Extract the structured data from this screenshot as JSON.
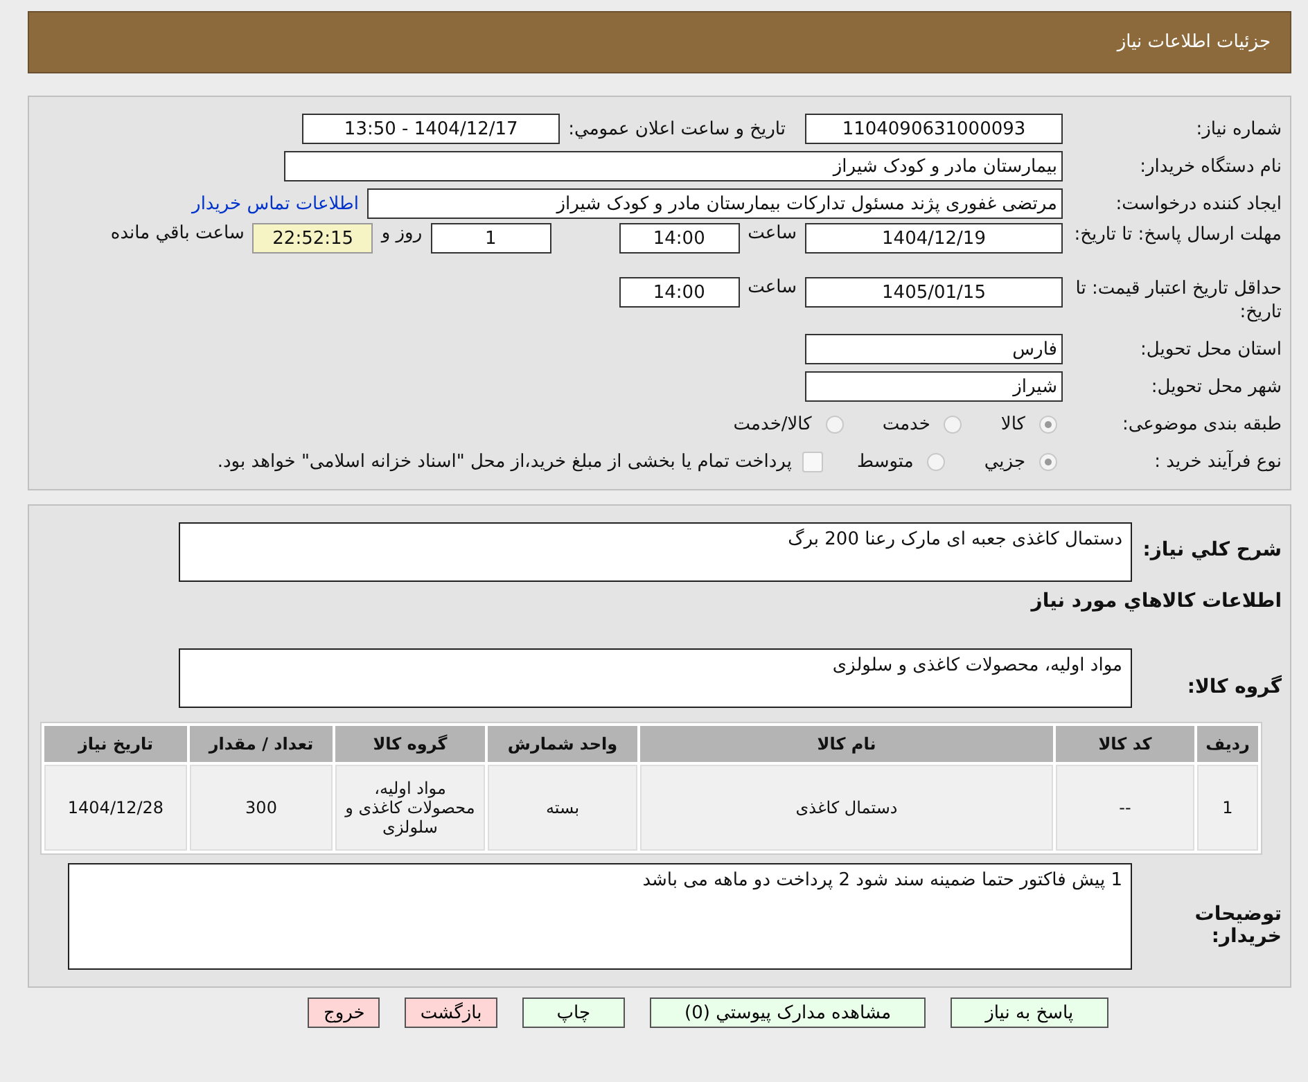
{
  "header": {
    "title": "جزئیات اطلاعات نیاز"
  },
  "need_number": {
    "label": "شماره نیاز:",
    "value": "1104090631000093"
  },
  "announce": {
    "label": "تاریخ و ساعت اعلان عمومي:",
    "value": "1404/12/17 - 13:50"
  },
  "buyer": {
    "label": "نام دستگاه خریدار:",
    "value": "بیمارستان مادر و کودک شیراز"
  },
  "requester": {
    "label": "ایجاد کننده درخواست:",
    "value": "مرتضی غفوری پژند مسئول تدارکات  بیمارستان مادر و کودک شیراز",
    "link": "اطلاعات تماس خریدار"
  },
  "deadline": {
    "label": "مهلت ارسال پاسخ: تا تاریخ:",
    "date": "1404/12/19",
    "time_label": "ساعت",
    "time": "14:00",
    "days": "1",
    "days_label": "روز و",
    "remaining": "22:52:15",
    "remaining_label": "ساعت باقي مانده"
  },
  "validity": {
    "label": "حداقل تاریخ اعتبار قیمت: تا تاریخ:",
    "date": "1405/01/15",
    "time_label": "ساعت",
    "time": "14:00"
  },
  "province": {
    "label": "استان محل تحویل:",
    "value": "فارس"
  },
  "city": {
    "label": "شهر محل تحویل:",
    "value": "شیراز"
  },
  "category": {
    "label": "طبقه بندی موضوعی:",
    "options": [
      {
        "label": "کالا",
        "selected": true
      },
      {
        "label": "خدمت",
        "selected": false
      },
      {
        "label": "کالا/خدمت",
        "selected": false
      }
    ]
  },
  "process": {
    "label": "نوع فرآیند خرید :",
    "options": [
      {
        "label": "جزيي",
        "selected": true
      },
      {
        "label": "متوسط",
        "selected": false
      }
    ],
    "payment": {
      "label": "پرداخت تمام یا بخشی از مبلغ خرید،از محل \"اسناد خزانه اسلامی\" خواهد بود.",
      "checked": false
    }
  },
  "description": {
    "label": "شرح کلي نیاز:",
    "value": "دستمال کاغذی جعبه ای مارک رعنا 200 برگ"
  },
  "goods_heading": "اطلاعات کالاهاي مورد نیاز",
  "group": {
    "label": "گروه کالا:",
    "value": "مواد اولیه، محصولات کاغذی و سلولزی"
  },
  "table": {
    "columns": [
      "ردیف",
      "کد کالا",
      "نام کالا",
      "واحد شمارش",
      "گروه کالا",
      "تعداد / مقدار",
      "تاریخ نیاز"
    ],
    "rows": [
      [
        "1",
        "--",
        "دستمال کاغذی",
        "بسته",
        "مواد اولیه، محصولات کاغذی و سلولزی",
        "300",
        "1404/12/28"
      ]
    ]
  },
  "notes": {
    "label": "توضیحات خریدار:",
    "value": "1 پیش فاکتور حتما ضمینه سند شود 2 پرداخت دو ماهه می باشد"
  },
  "buttons": [
    {
      "label": "پاسخ به نیاز",
      "kind": "normal"
    },
    {
      "label": "مشاهده مدارک پیوستي (0)",
      "kind": "normal"
    },
    {
      "label": "چاپ",
      "kind": "normal"
    },
    {
      "label": "بازگشت",
      "kind": "danger"
    },
    {
      "label": "خروج",
      "kind": "danger"
    }
  ]
}
